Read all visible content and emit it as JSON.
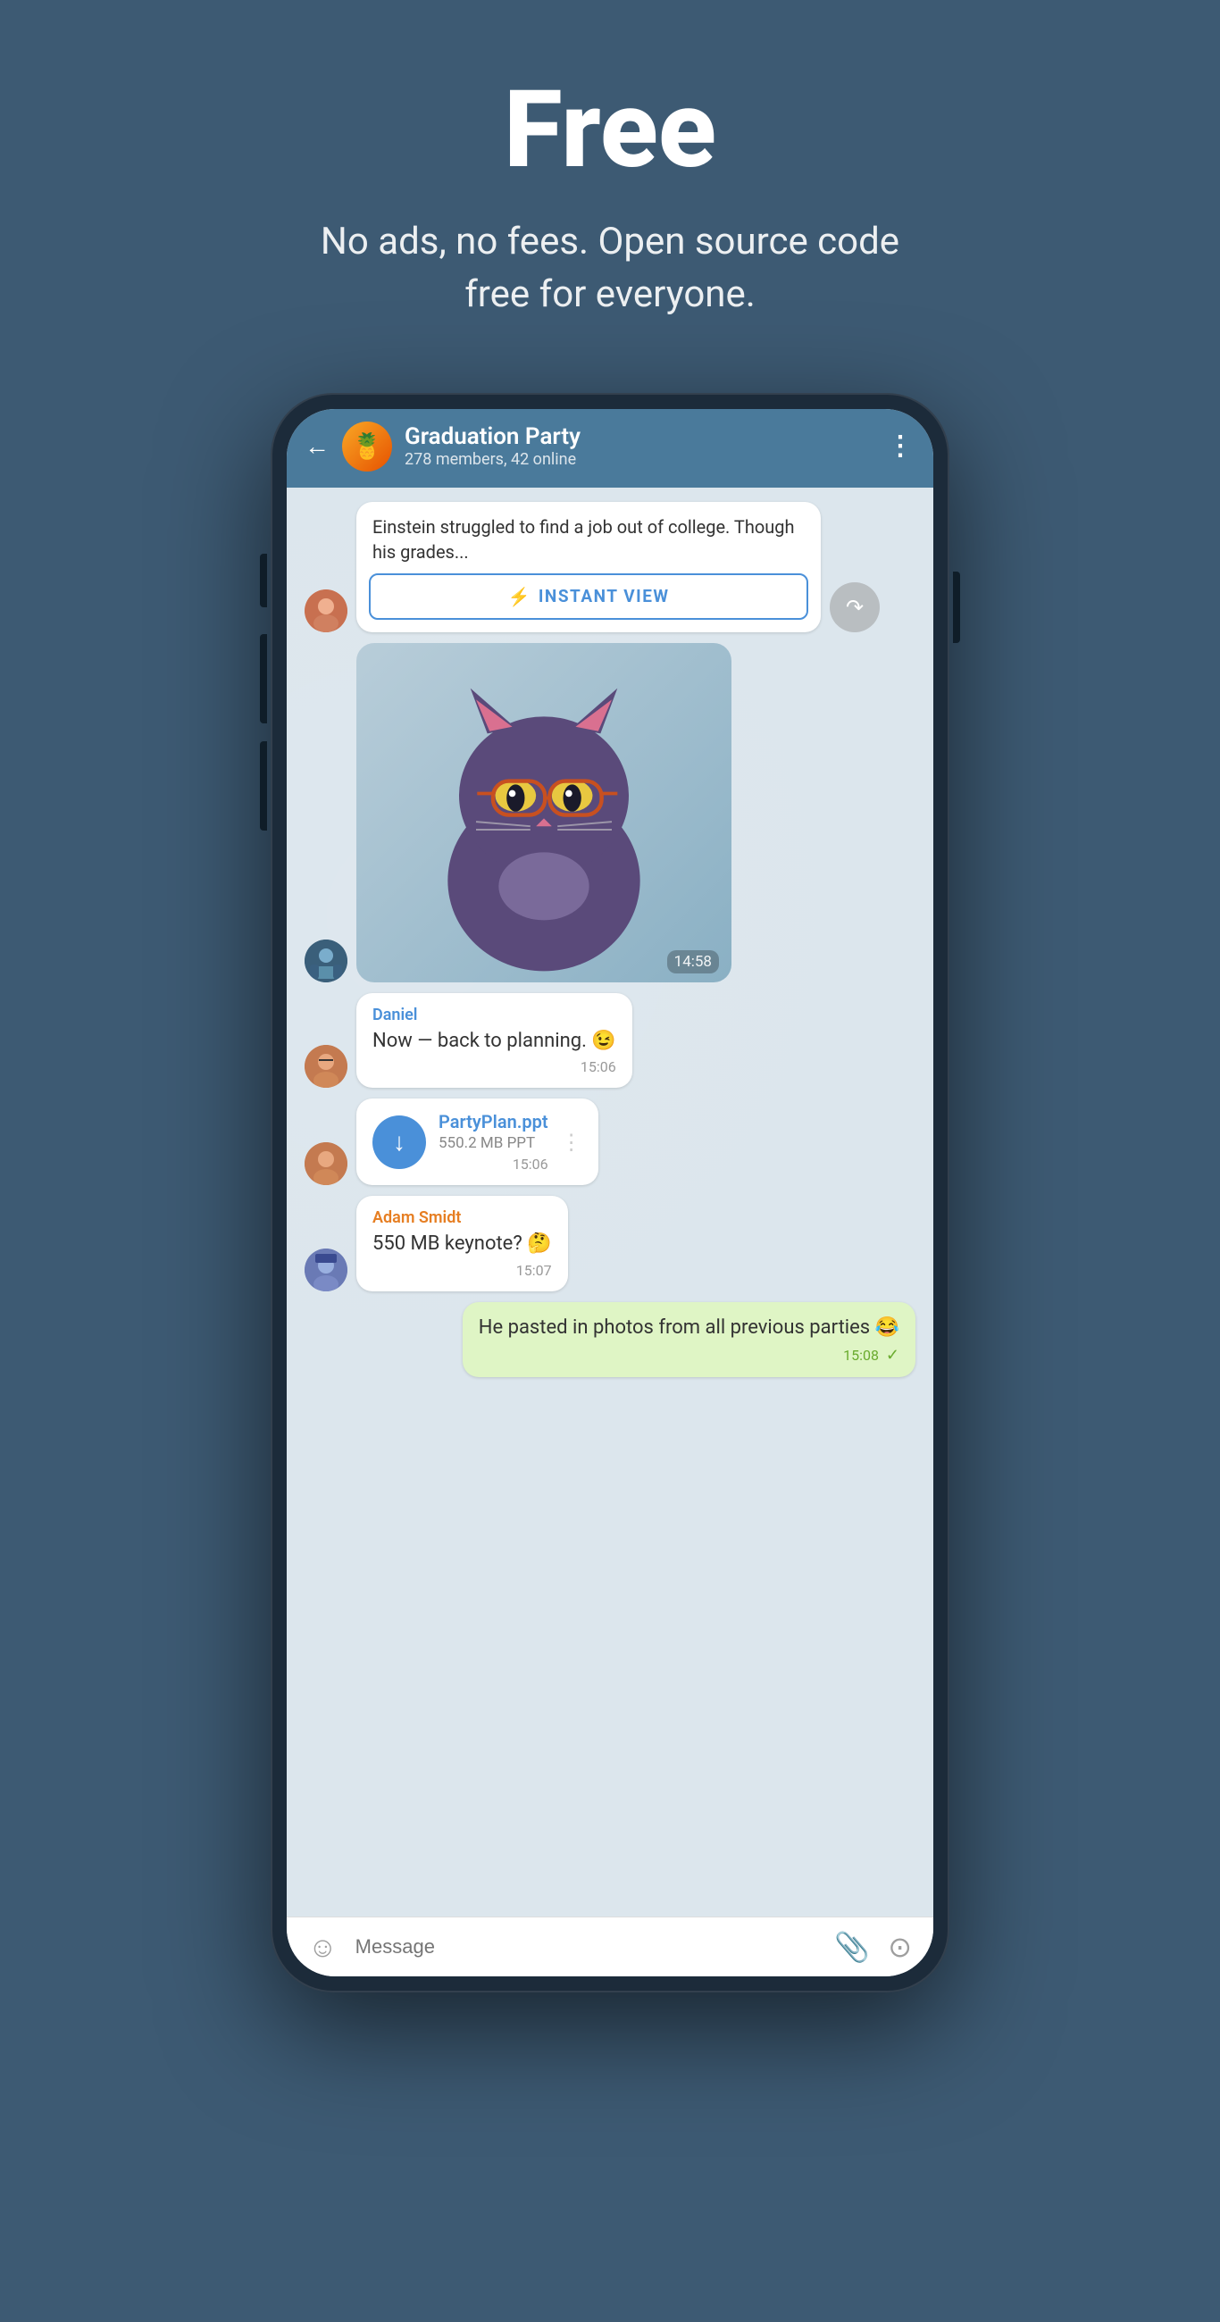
{
  "hero": {
    "title": "Free",
    "subtitle": "No ads, no fees. Open source code free for everyone."
  },
  "chat": {
    "back_label": "←",
    "group_name": "Graduation Party",
    "group_meta": "278 members, 42 online",
    "menu_icon": "⋮",
    "avatar_emoji": "🍍"
  },
  "messages": [
    {
      "id": "article-msg",
      "type": "article",
      "text": "Einstein struggled to find a job out of college. Though his grades...",
      "instant_view_label": "INSTANT VIEW",
      "time": ""
    },
    {
      "id": "sticker-msg",
      "type": "sticker",
      "time": "14:58"
    },
    {
      "id": "daniel-msg",
      "type": "text",
      "sender": "Daniel",
      "text": "Now — back to planning. 😉",
      "time": "15:06"
    },
    {
      "id": "file-msg",
      "type": "file",
      "file_name": "PartyPlan.ppt",
      "file_size": "550.2 MB PPT",
      "time": "15:06"
    },
    {
      "id": "adam-msg",
      "type": "text",
      "sender": "Adam Smidt",
      "text": "550 MB keynote? 🤔",
      "time": "15:07"
    },
    {
      "id": "own-msg",
      "type": "own",
      "text": "He pasted in photos from all previous parties 😂",
      "time": "15:08"
    }
  ],
  "input_bar": {
    "placeholder": "Message",
    "emoji_icon": "☺",
    "attach_icon": "📎",
    "camera_icon": "⊙"
  },
  "colors": {
    "bg": "#3d5a73",
    "header": "#4a7a9b",
    "messages_bg": "#dce6ed",
    "bubble_white": "#ffffff",
    "bubble_green": "#dff5c5",
    "accent_blue": "#4a90d9",
    "sender_blue": "#4a90d9",
    "sender_orange": "#e67e22",
    "time_color": "#999999",
    "time_green": "#6aab2e"
  }
}
